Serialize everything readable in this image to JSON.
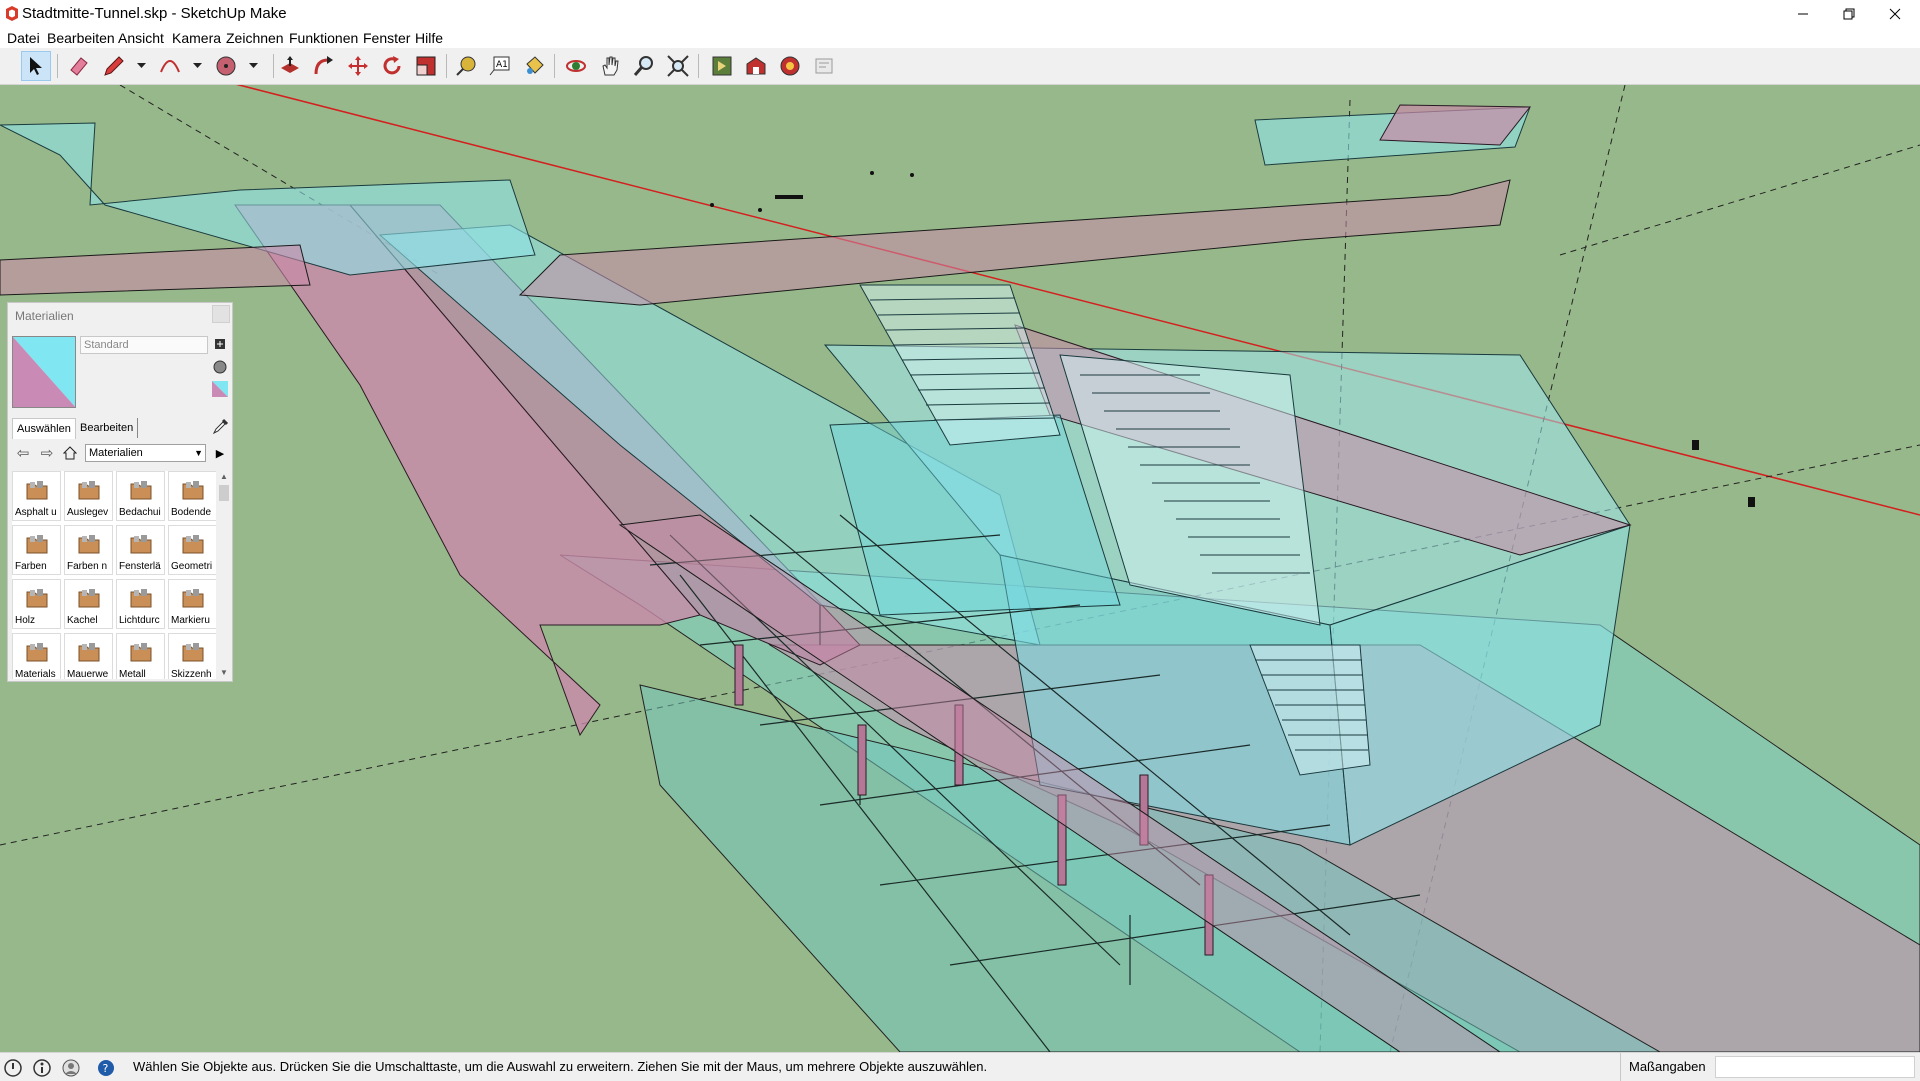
{
  "window": {
    "title": "Stadtmitte-Tunnel.skp - SketchUp Make",
    "icons": {
      "app": "sketchup-logo-icon",
      "minimize": "minimize-icon",
      "maximize": "restore-icon",
      "close": "close-icon"
    }
  },
  "menu": [
    "Datei",
    "Bearbeiten",
    "Ansicht",
    "Kamera",
    "Zeichnen",
    "Funktionen",
    "Fenster",
    "Hilfe"
  ],
  "toolbar": {
    "tools": [
      "select-arrow",
      "eraser",
      "line-pencil",
      "arc",
      "circle",
      "push-pull",
      "follow-me",
      "move",
      "rotate",
      "scale",
      "tape-measure",
      "text",
      "paint-bucket",
      "orbit",
      "pan",
      "zoom",
      "zoom-extents",
      "get-models",
      "3d-warehouse",
      "extension-warehouse",
      "layout"
    ],
    "active_tool": "select-arrow"
  },
  "materials": {
    "panel_title": "Materialien",
    "current_material": "Standard",
    "tabs": [
      "Auswählen",
      "Bearbeiten"
    ],
    "library": "Materialien",
    "items": [
      "Asphalt u",
      "Auslegev",
      "Bedachui",
      "Bodende",
      "Farben",
      "Farben n",
      "Fensterlä",
      "Geometri",
      "Holz",
      "Kachel",
      "Lichtdurc",
      "Markieru",
      "Materials",
      "Mauerwe",
      "Metall",
      "Skizzenh"
    ]
  },
  "status": {
    "message": "Wählen Sie Objekte aus. Drücken Sie die Umschalttaste, um die Auswahl zu erweitern. Ziehen Sie mit der Maus, um mehrere Objekte auszuwählen.",
    "measurements_label": "Maßangaben",
    "measurements_value": ""
  },
  "colors": {
    "ground": "#97b88a",
    "glass_cyan": "#7fe0ea",
    "pink_wall": "#c98aa9",
    "axis_red": "#d41f1f",
    "axis_dashed": "#222222"
  }
}
